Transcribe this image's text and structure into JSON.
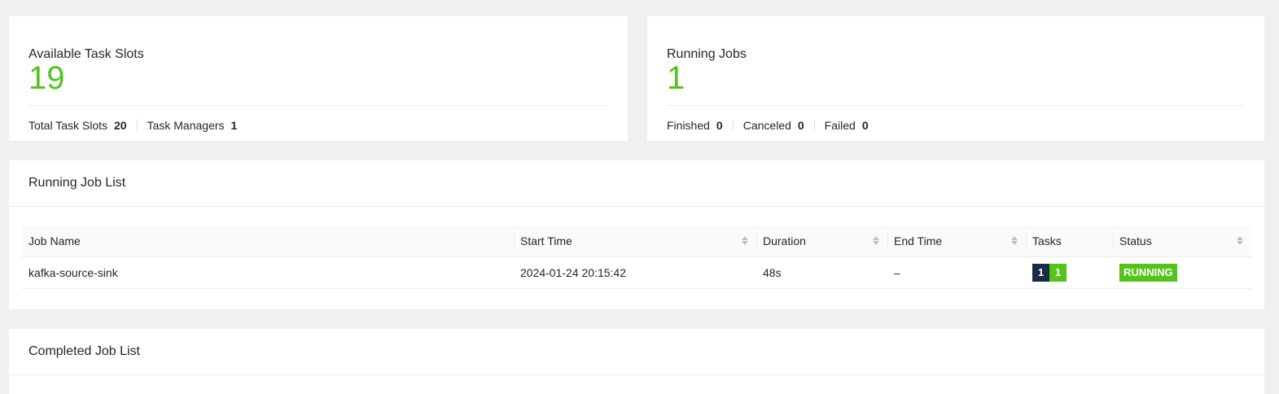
{
  "task_slots_card": {
    "title": "Available Task Slots",
    "value": "19",
    "total_label": "Total Task Slots",
    "total_value": "20",
    "managers_label": "Task Managers",
    "managers_value": "1"
  },
  "running_jobs_card": {
    "title": "Running Jobs",
    "value": "1",
    "finished_label": "Finished",
    "finished_value": "0",
    "canceled_label": "Canceled",
    "canceled_value": "0",
    "failed_label": "Failed",
    "failed_value": "0"
  },
  "running_list": {
    "title": "Running Job List",
    "columns": [
      "Job Name",
      "Start Time",
      "Duration",
      "End Time",
      "Tasks",
      "Status"
    ],
    "rows": [
      {
        "job_name": "kafka-source-sink",
        "start_time": "2024-01-24 20:15:42",
        "duration": "48s",
        "end_time": "–",
        "tasks_a": "1",
        "tasks_b": "1",
        "status": "RUNNING"
      }
    ]
  },
  "completed_list": {
    "title": "Completed Job List"
  },
  "colors": {
    "accent_green": "#52c41a",
    "task_dark": "#1c2a46"
  }
}
